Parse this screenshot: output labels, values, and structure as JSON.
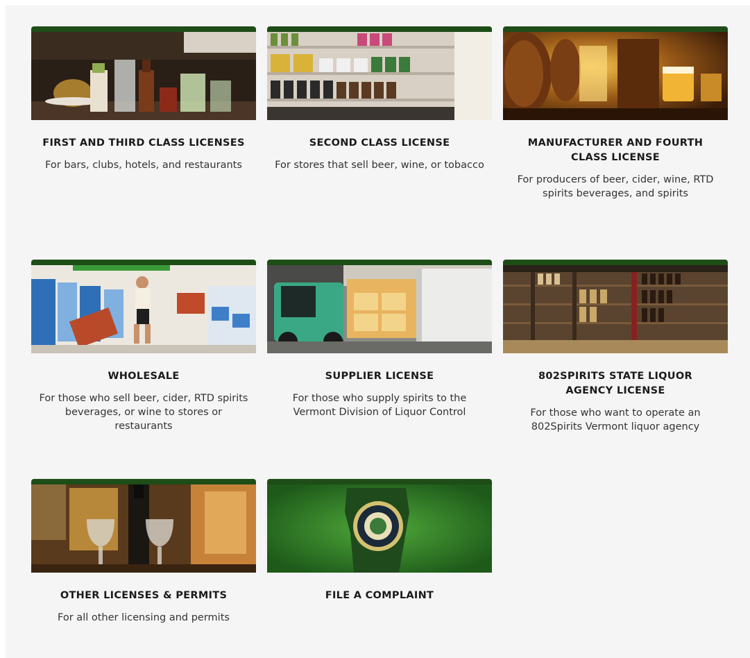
{
  "cards": [
    {
      "title": "FIRST AND THIRD CLASS LICENSES",
      "description": "For bars, clubs, hotels, and restaurants",
      "image": "bar-cocktails-image"
    },
    {
      "title": "SECOND CLASS LICENSE",
      "description": "For stores that sell beer, wine, or tobacco",
      "image": "store-shelves-image"
    },
    {
      "title": "MANUFACTURER AND FOURTH CLASS LICENSE",
      "description": "For producers of beer, cider, wine, RTD spirits beverages, and spirits",
      "image": "barrel-cellar-image"
    },
    {
      "title": "WHOLESALE",
      "description": "For those who sell beer, cider, RTD spirits beverages, or wine to stores or restaurants",
      "image": "delivery-worker-image"
    },
    {
      "title": "SUPPLIER LICENSE",
      "description": "For those who supply spirits to the Vermont Division of Liquor Control",
      "image": "forklift-truck-image"
    },
    {
      "title": "802SPIRITS STATE LIQUOR AGENCY LICENSE",
      "description": "For those who want to operate an 802Spirits Vermont liquor agency",
      "image": "liquor-store-shelves-image"
    },
    {
      "title": "OTHER LICENSES & PERMITS",
      "description": "For all other licensing and permits",
      "image": "wine-glasses-image"
    },
    {
      "title": "FILE A COMPLAINT",
      "description": "",
      "image": "vermont-seal-image"
    }
  ],
  "colors": {
    "card_top_border": "#1e4d18",
    "panel_background": "#f5f5f5",
    "title_text": "#1a1a1a",
    "description_text": "#333333"
  }
}
